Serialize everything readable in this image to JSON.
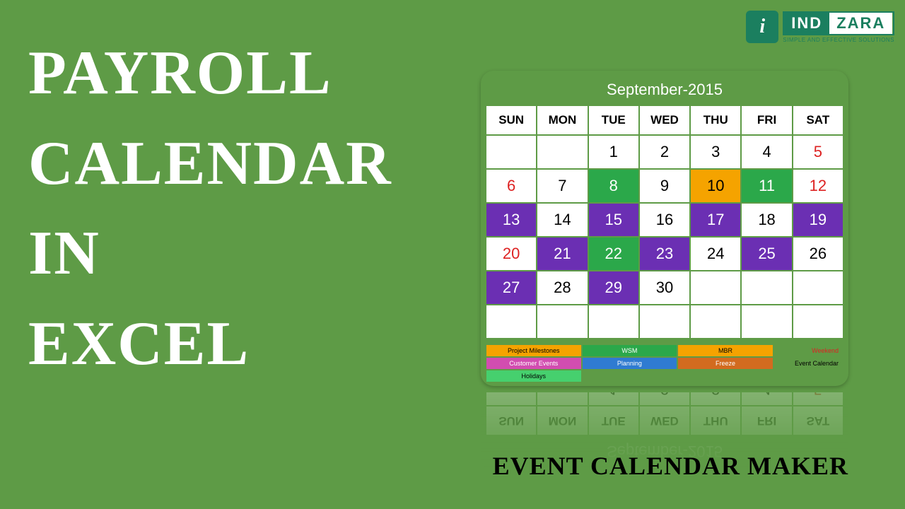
{
  "title_lines": [
    "PAYROLL",
    "CALENDAR",
    "IN",
    "EXCEL"
  ],
  "subtitle": "EVENT CALENDAR MAKER",
  "logo": {
    "icon_letter": "i",
    "brand_a": "IND",
    "brand_b": "ZARA",
    "tagline": "SIMPLE AND EFFECTIVE SOLUTIONS"
  },
  "calendar": {
    "month_label": "September-2015",
    "day_headers": [
      "SUN",
      "MON",
      "TUE",
      "WED",
      "THU",
      "FRI",
      "SAT"
    ],
    "cells": [
      {
        "n": "",
        "c": ""
      },
      {
        "n": "",
        "c": ""
      },
      {
        "n": "1",
        "c": ""
      },
      {
        "n": "2",
        "c": ""
      },
      {
        "n": "3",
        "c": ""
      },
      {
        "n": "4",
        "c": ""
      },
      {
        "n": "5",
        "c": "weekend"
      },
      {
        "n": "6",
        "c": "weekend"
      },
      {
        "n": "7",
        "c": ""
      },
      {
        "n": "8",
        "c": "green"
      },
      {
        "n": "9",
        "c": ""
      },
      {
        "n": "10",
        "c": "orange"
      },
      {
        "n": "11",
        "c": "green"
      },
      {
        "n": "12",
        "c": "weekend"
      },
      {
        "n": "13",
        "c": "purple"
      },
      {
        "n": "14",
        "c": ""
      },
      {
        "n": "15",
        "c": "purple"
      },
      {
        "n": "16",
        "c": ""
      },
      {
        "n": "17",
        "c": "purple"
      },
      {
        "n": "18",
        "c": ""
      },
      {
        "n": "19",
        "c": "purple"
      },
      {
        "n": "20",
        "c": "weekend"
      },
      {
        "n": "21",
        "c": "purple"
      },
      {
        "n": "22",
        "c": "green"
      },
      {
        "n": "23",
        "c": "purple"
      },
      {
        "n": "24",
        "c": ""
      },
      {
        "n": "25",
        "c": "purple"
      },
      {
        "n": "26",
        "c": ""
      },
      {
        "n": "27",
        "c": "purple"
      },
      {
        "n": "28",
        "c": ""
      },
      {
        "n": "29",
        "c": "purple"
      },
      {
        "n": "30",
        "c": ""
      },
      {
        "n": "",
        "c": ""
      },
      {
        "n": "",
        "c": ""
      },
      {
        "n": "",
        "c": ""
      },
      {
        "n": "",
        "c": ""
      },
      {
        "n": "",
        "c": ""
      },
      {
        "n": "",
        "c": ""
      },
      {
        "n": "",
        "c": ""
      },
      {
        "n": "",
        "c": ""
      },
      {
        "n": "",
        "c": ""
      },
      {
        "n": "",
        "c": ""
      }
    ]
  },
  "legend": {
    "project_milestones": "Project Milestones",
    "customer_events": "Customer Events",
    "holidays": "Holidays",
    "wsm": "WSM",
    "planning": "Planning",
    "mbr": "MBR",
    "freeze": "Freeze",
    "weekend": "Weekend",
    "event_calendar": "Event Calendar"
  }
}
